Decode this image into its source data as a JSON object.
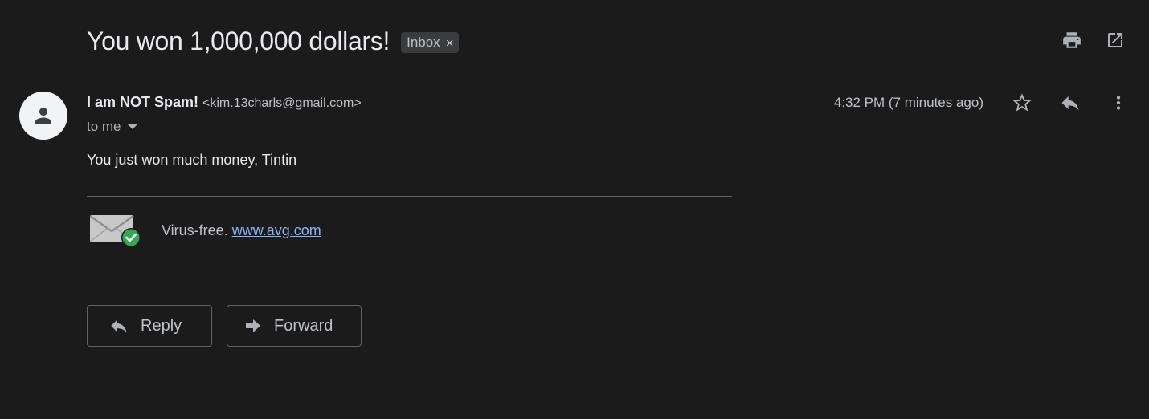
{
  "email": {
    "subject": "You won 1,000,000 dollars!",
    "label": "Inbox",
    "label_remove": "×",
    "sender_name": "I am NOT Spam!",
    "sender_email": "<kim.13charls@gmail.com>",
    "recipients": "to me",
    "timestamp": "4:32 PM (7 minutes ago)",
    "body": "You just won much money, Tintin",
    "signature": {
      "text": "Virus-free.",
      "link": "www.avg.com"
    }
  },
  "actions": {
    "reply_label": "Reply",
    "forward_label": "Forward"
  },
  "icons": {
    "print": "print-icon",
    "open_new_window": "open-in-new-icon",
    "star": "star-icon",
    "reply": "reply-icon",
    "more": "more-vert-icon",
    "avatar": "person-icon",
    "envelope": "envelope-check-icon"
  },
  "colors": {
    "background": "#1b1b1c",
    "link": "#8ab4f8",
    "check_badge": "#34a853"
  }
}
